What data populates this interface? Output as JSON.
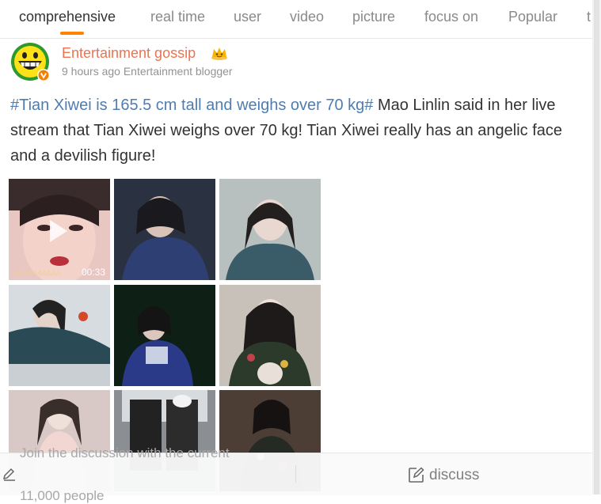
{
  "tabs": [
    {
      "label": "comprehensive",
      "active": true
    },
    {
      "label": "real time",
      "active": false
    },
    {
      "label": "user",
      "active": false
    },
    {
      "label": "video",
      "active": false
    },
    {
      "label": "picture",
      "active": false
    },
    {
      "label": "focus on",
      "active": false
    },
    {
      "label": "Popular",
      "active": false
    },
    {
      "label": "t",
      "active": false
    }
  ],
  "post": {
    "author": "Entertainment gossip",
    "time": "9 hours ago",
    "author_desc": "Entertainment blogger",
    "topic": "#Tian Xiwei is 165.5 cm tall and weighs over 70 kg#",
    "body": " Mao Linlin said in her live stream that Tian Xiwei weighs over 70 kg! Tian Xiwei really has an angelic face and a devilish figure!",
    "video_duration": "00:33",
    "video_badge": "◬◬◬◬◬◬◬◬◬◬"
  },
  "bottom": {
    "placeholder_line1": "Join the discussion with the current",
    "placeholder_line2": "11,000 people",
    "discuss_label": "discuss"
  },
  "colors": {
    "accent": "#ff8200",
    "author": "#eb7350",
    "topic": "#507daf"
  },
  "icons": [
    "play-icon",
    "crown-icon",
    "verified-badge-icon",
    "edit-icon",
    "discuss-icon"
  ]
}
